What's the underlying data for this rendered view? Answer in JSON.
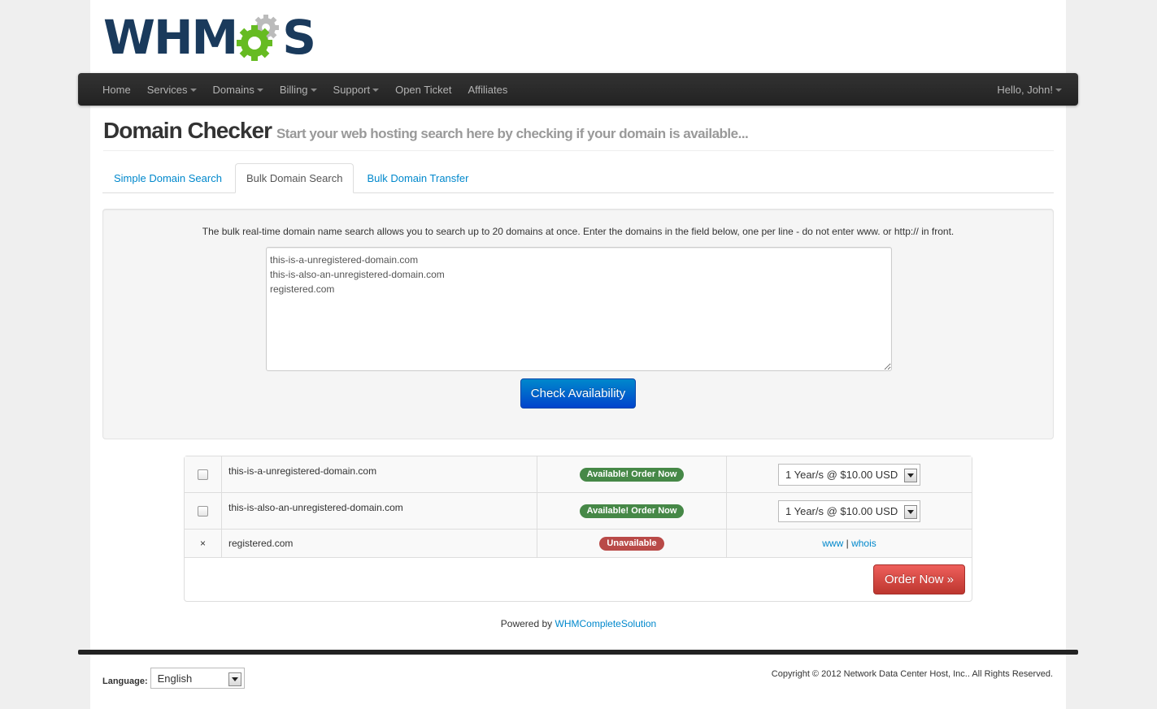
{
  "brand": {
    "logo_left": "WHM",
    "logo_right": "S",
    "colors": {
      "navy": "#1a3a5c",
      "green": "#66bb22",
      "grey": "#bbbbbb"
    }
  },
  "nav": {
    "items": [
      {
        "label": "Home",
        "dropdown": false
      },
      {
        "label": "Services",
        "dropdown": true
      },
      {
        "label": "Domains",
        "dropdown": true
      },
      {
        "label": "Billing",
        "dropdown": true
      },
      {
        "label": "Support",
        "dropdown": true
      },
      {
        "label": "Open Ticket",
        "dropdown": false
      },
      {
        "label": "Affiliates",
        "dropdown": false
      }
    ],
    "user": "Hello, John!"
  },
  "page": {
    "title": "Domain Checker",
    "subtitle": "Start your web hosting search here by checking if your domain is available..."
  },
  "tabs": [
    {
      "label": "Simple Domain Search",
      "active": false
    },
    {
      "label": "Bulk Domain Search",
      "active": true
    },
    {
      "label": "Bulk Domain Transfer",
      "active": false
    }
  ],
  "bulk": {
    "intro": "The bulk real-time domain name search allows you to search up to 20 domains at once. Enter the domains in the field below, one per line - do not enter www. or http:// in front.",
    "domains_text": "this-is-a-unregistered-domain.com\nthis-is-also-an-unregistered-domain.com\nregistered.com",
    "check_button": "Check Availability"
  },
  "results": {
    "rows": [
      {
        "domain": "this-is-a-unregistered-domain.com",
        "status": "Available! Order Now",
        "option": "1 Year/s @ $10.00 USD"
      },
      {
        "domain": "this-is-also-an-unregistered-domain.com",
        "status": "Available! Order Now",
        "option": "1 Year/s @ $10.00 USD"
      },
      {
        "domain": "registered.com",
        "status": "Unavailable",
        "marker": "×",
        "link_www": "www",
        "link_sep": "|",
        "link_whois": "whois"
      }
    ],
    "order_button": "Order Now »"
  },
  "footer": {
    "powered_prefix": "Powered by",
    "powered_link": "WHMCompleteSolution",
    "language_label": "Language:",
    "language_value": "English",
    "copyright": "Copyright © 2012 Network Data Center Host, Inc.. All Rights Reserved."
  }
}
